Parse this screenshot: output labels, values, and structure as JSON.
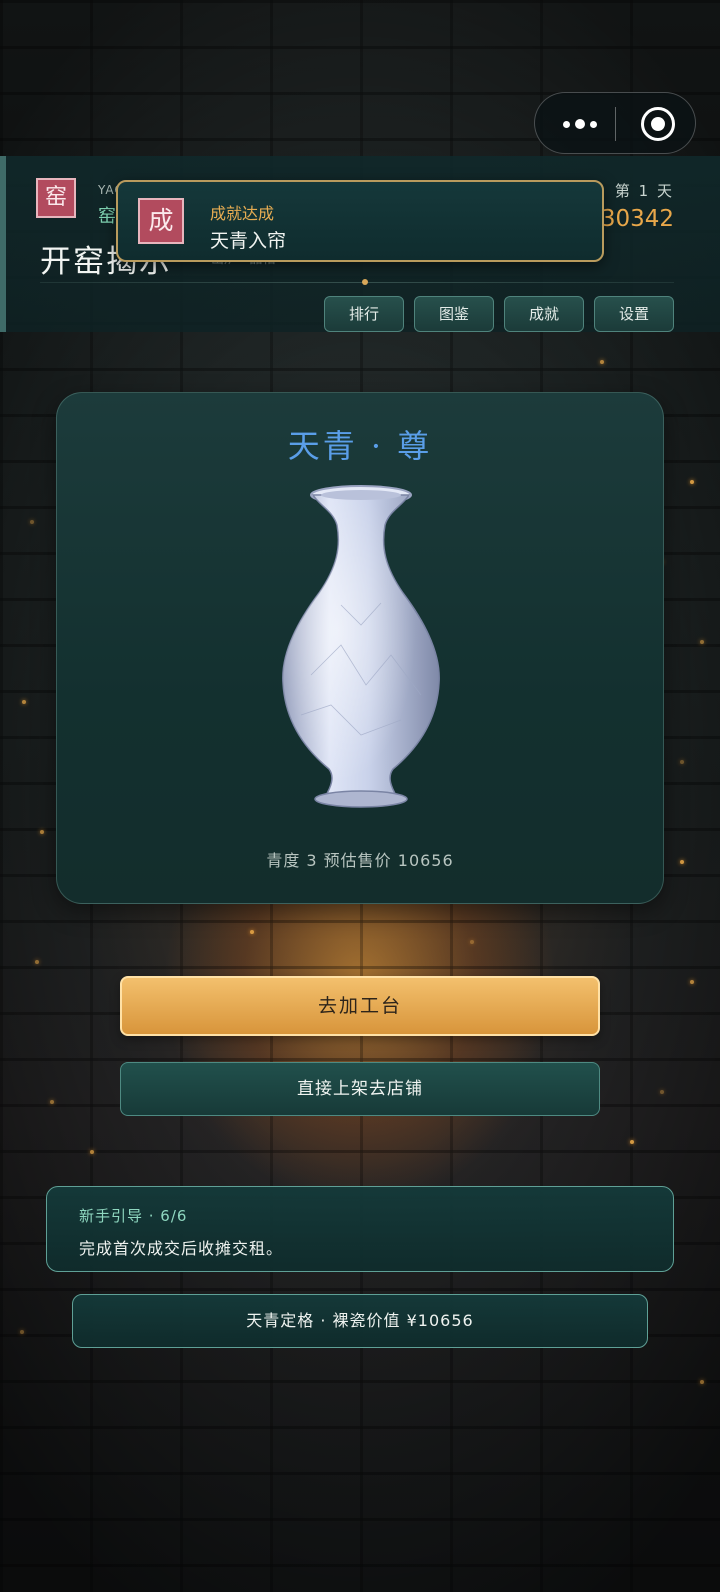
{
  "capsule": {
    "more_icon": "more-dots-icon",
    "close_icon": "target-circle-icon"
  },
  "header": {
    "kiln_seal": "窑",
    "brand": "YAO",
    "kiln_label": "窑火",
    "title": "开窑揭示",
    "sub_info": "出炉 · 品相",
    "day": "第 1 天",
    "money": "¥30342",
    "tabs": [
      "排行",
      "图鉴",
      "成就",
      "设置"
    ]
  },
  "toast": {
    "seal": "成",
    "heading": "成就达成",
    "body": "天青入帘"
  },
  "vase_card": {
    "name": "天青 · 尊",
    "stats": "青度 3  预估售价 10656",
    "glaze_color": "#c9d2ea"
  },
  "actions": {
    "primary_label": "去加工台",
    "secondary_label": "直接上架去店铺"
  },
  "guide": {
    "title": "新手引导 · 6/6",
    "text": "完成首次成交后收摊交租。"
  },
  "value_bar": {
    "text": "天青定格 · 裸瓷价值 ¥10656"
  },
  "colors": {
    "accent_gold": "#e8a74a",
    "seal_red": "#b24b5e",
    "teal_panel": "#173a38",
    "vase_title_blue": "#5a9ee8"
  }
}
